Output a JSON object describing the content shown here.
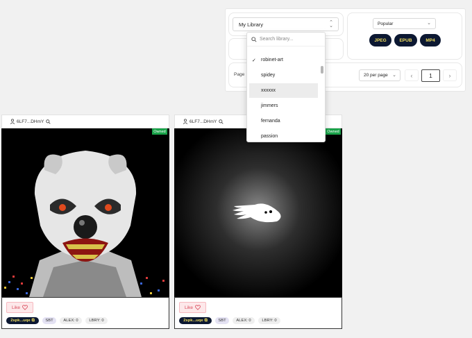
{
  "library_select": {
    "value": "My Library"
  },
  "sort_select": {
    "value": "Popular"
  },
  "format_pills": [
    "JPEG",
    "EPUB",
    "MP4"
  ],
  "pagination": {
    "label": "Page ",
    "per_page": "20 per page",
    "prev": "‹",
    "next": "›",
    "current": "1"
  },
  "dropdown": {
    "placeholder": "Search library...",
    "items": [
      {
        "label": "robinet-art",
        "selected": true
      },
      {
        "label": "spidey",
        "selected": false
      },
      {
        "label": "xxxxxx",
        "selected": false,
        "highlighted": true
      },
      {
        "label": "jimmers",
        "selected": false
      },
      {
        "label": "fernanda",
        "selected": false
      },
      {
        "label": "passion",
        "selected": false
      }
    ]
  },
  "cards": [
    {
      "owner": "6LF7...DHmY",
      "owned": "Owned",
      "like": "Like",
      "token": "2spk...uqe",
      "sbt": "SBT",
      "alex": "ALEX: 0",
      "lbry": "LBRY: 0"
    },
    {
      "owner": "6LF7...DHmY",
      "owned": "Owned",
      "like": "Like",
      "token": "2spk...uqe",
      "sbt": "SBT",
      "alex": "ALEX: 0",
      "lbry": "LBRY: 0"
    }
  ],
  "colors": {
    "accent_dark": "#0c1832",
    "accent_yellow": "#f2df5f",
    "owned_green": "#1aa34a",
    "like_red": "#d94a5a"
  }
}
